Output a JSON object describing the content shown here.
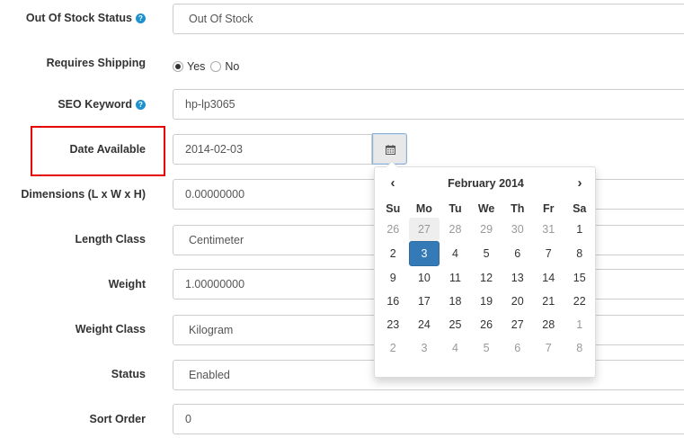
{
  "form": {
    "out_of_stock": {
      "label": "Out Of Stock Status",
      "value": "Out Of Stock"
    },
    "requires_shipping": {
      "label": "Requires Shipping",
      "options": [
        "Yes",
        "No"
      ],
      "selected": "Yes"
    },
    "seo_keyword": {
      "label": "SEO Keyword",
      "value": "hp-lp3065"
    },
    "date_available": {
      "label": "Date Available",
      "value": "2014-02-03"
    },
    "dimensions": {
      "label": "Dimensions (L x W x H)",
      "value": "0.00000000"
    },
    "length_class": {
      "label": "Length Class",
      "value": "Centimeter"
    },
    "weight": {
      "label": "Weight",
      "value": "1.00000000"
    },
    "weight_class": {
      "label": "Weight Class",
      "value": "Kilogram"
    },
    "status": {
      "label": "Status",
      "value": "Enabled"
    },
    "sort_order": {
      "label": "Sort Order",
      "value": "0"
    }
  },
  "help_icon": "?",
  "icons": {
    "help": "question-circle-icon",
    "calendar": "calendar-icon",
    "prev": "chevron-left-icon",
    "next": "chevron-right-icon"
  },
  "datepicker": {
    "title": "February 2014",
    "prev": "‹",
    "next": "›",
    "weekdays": [
      "Su",
      "Mo",
      "Tu",
      "We",
      "Th",
      "Fr",
      "Sa"
    ],
    "weeks": [
      [
        "26",
        "27",
        "28",
        "29",
        "30",
        "31",
        "1"
      ],
      [
        "2",
        "3",
        "4",
        "5",
        "6",
        "7",
        "8"
      ],
      [
        "9",
        "10",
        "11",
        "12",
        "13",
        "14",
        "15"
      ],
      [
        "16",
        "17",
        "18",
        "19",
        "20",
        "21",
        "22"
      ],
      [
        "23",
        "24",
        "25",
        "26",
        "27",
        "28",
        "1"
      ],
      [
        "2",
        "3",
        "4",
        "5",
        "6",
        "7",
        "8"
      ]
    ],
    "selected_day": "3"
  },
  "colors": {
    "highlight_box": "#e60000",
    "selected_day_bg": "#337ab7",
    "help_icon": "#1e91cf"
  }
}
